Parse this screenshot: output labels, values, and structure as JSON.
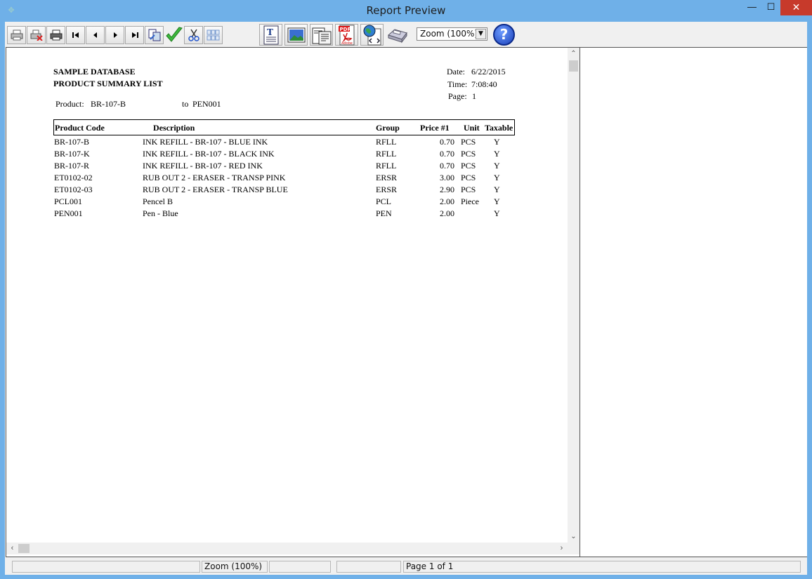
{
  "window": {
    "title": "Report Preview",
    "minimize": "—",
    "maximize": "☐",
    "close": "✕"
  },
  "toolbar": {
    "zoom_value": "Zoom (100%)",
    "help_label": "?"
  },
  "report": {
    "company": "SAMPLE DATABASE",
    "report_title": "PRODUCT SUMMARY LIST",
    "range_label": "Product:",
    "range_from": "BR-107-B",
    "range_to_label": "to",
    "range_to": "PEN001",
    "date_label": "Date:",
    "date_value": "6/22/2015",
    "time_label": "Time:",
    "time_value": "7:08:40",
    "page_label": "Page:",
    "page_value": "1",
    "columns": [
      "Product Code",
      "Description",
      "Group",
      "Price #1",
      "Unit",
      "Taxable"
    ],
    "rows": [
      {
        "code": "BR-107-B",
        "desc": "INK REFILL - BR-107 - BLUE INK",
        "group": "RFLL",
        "price": "0.70",
        "unit": "PCS",
        "taxable": "Y"
      },
      {
        "code": "BR-107-K",
        "desc": "INK REFILL - BR-107 - BLACK INK",
        "group": "RFLL",
        "price": "0.70",
        "unit": "PCS",
        "taxable": "Y"
      },
      {
        "code": "BR-107-R",
        "desc": "INK REFILL - BR-107 - RED INK",
        "group": "RFLL",
        "price": "0.70",
        "unit": "PCS",
        "taxable": "Y"
      },
      {
        "code": "ET0102-02",
        "desc": "RUB OUT 2 - ERASER - TRANSP PINK",
        "group": "ERSR",
        "price": "3.00",
        "unit": "PCS",
        "taxable": "Y"
      },
      {
        "code": "ET0102-03",
        "desc": "RUB OUT 2 - ERASER - TRANSP BLUE",
        "group": "ERSR",
        "price": "2.90",
        "unit": "PCS",
        "taxable": "Y"
      },
      {
        "code": "PCL001",
        "desc": "Pencel B",
        "group": "PCL",
        "price": "2.00",
        "unit": "Piece",
        "taxable": "Y"
      },
      {
        "code": "PEN001",
        "desc": "Pen - Blue",
        "group": "PEN",
        "price": "2.00",
        "unit": "",
        "taxable": "Y"
      }
    ]
  },
  "statusbar": {
    "zoom": "Zoom (100%)",
    "page_info": "Page 1 of 1"
  },
  "colors": {
    "titlebar": "#6fb0e8",
    "close": "#c73a2b"
  }
}
